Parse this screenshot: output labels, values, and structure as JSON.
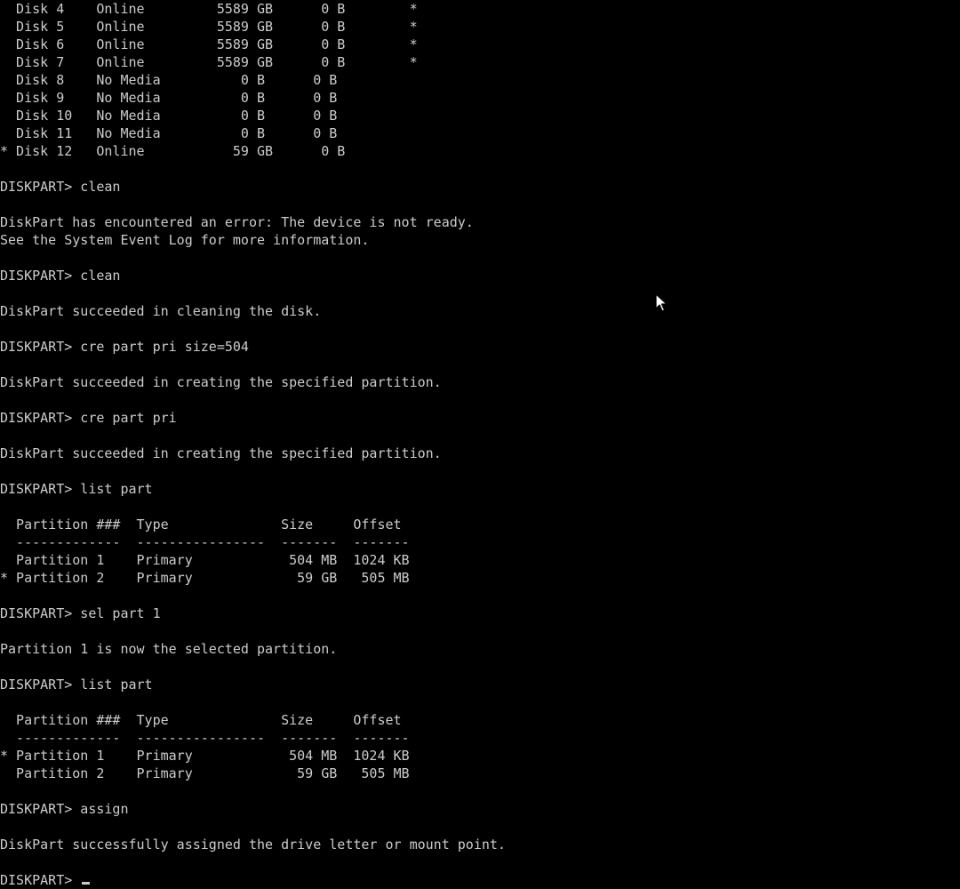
{
  "colors": {
    "background": "#000000",
    "text": "#cccccc"
  },
  "console": {
    "prompt": "DISKPART> ",
    "lines": [
      "  Disk 4    Online         5589 GB      0 B        *",
      "  Disk 5    Online         5589 GB      0 B        *",
      "  Disk 6    Online         5589 GB      0 B        *",
      "  Disk 7    Online         5589 GB      0 B        *",
      "  Disk 8    No Media          0 B      0 B",
      "  Disk 9    No Media          0 B      0 B",
      "  Disk 10   No Media          0 B      0 B",
      "  Disk 11   No Media          0 B      0 B",
      "* Disk 12   Online           59 GB      0 B",
      "",
      "DISKPART> clean",
      "",
      "DiskPart has encountered an error: The device is not ready.",
      "See the System Event Log for more information.",
      "",
      "DISKPART> clean",
      "",
      "DiskPart succeeded in cleaning the disk.",
      "",
      "DISKPART> cre part pri size=504",
      "",
      "DiskPart succeeded in creating the specified partition.",
      "",
      "DISKPART> cre part pri",
      "",
      "DiskPart succeeded in creating the specified partition.",
      "",
      "DISKPART> list part",
      "",
      "  Partition ###  Type              Size     Offset",
      "  -------------  ----------------  -------  -------",
      "  Partition 1    Primary            504 MB  1024 KB",
      "* Partition 2    Primary             59 GB   505 MB",
      "",
      "DISKPART> sel part 1",
      "",
      "Partition 1 is now the selected partition.",
      "",
      "DISKPART> list part",
      "",
      "  Partition ###  Type              Size     Offset",
      "  -------------  ----------------  -------  -------",
      "* Partition 1    Primary            504 MB  1024 KB",
      "  Partition 2    Primary             59 GB   505 MB",
      "",
      "DISKPART> assign",
      "",
      "DiskPart successfully assigned the drive letter or mount point.",
      ""
    ]
  },
  "icons": {
    "pointer": "mouse-pointer-icon"
  }
}
